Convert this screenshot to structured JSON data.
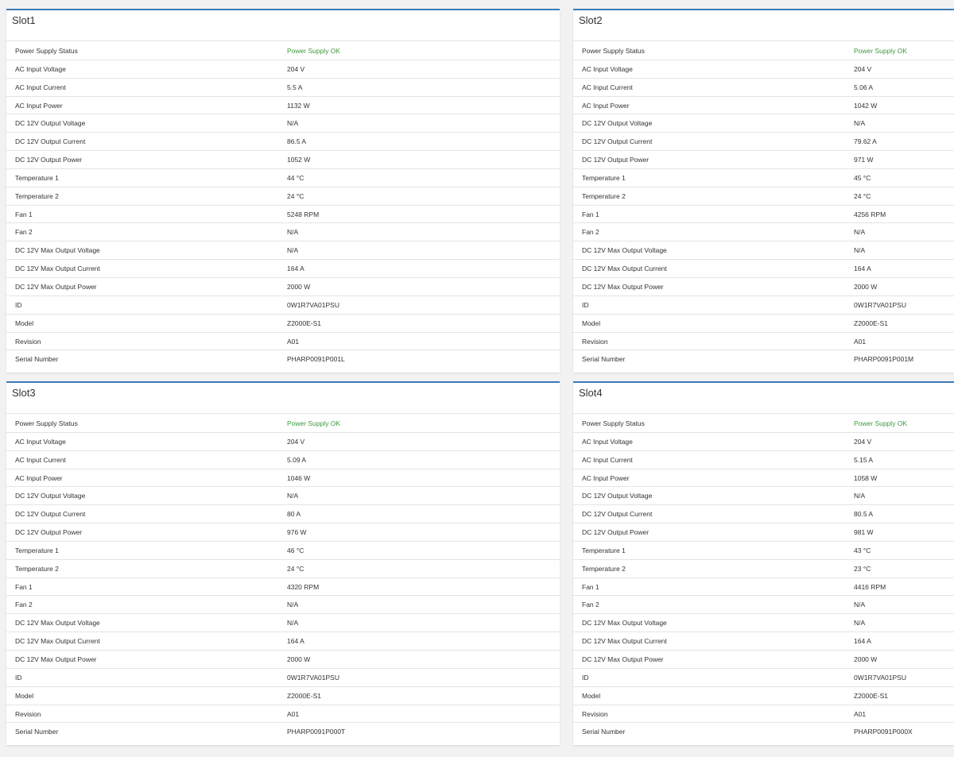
{
  "colors": {
    "accent": "#3c7ab8",
    "ok": "#3c9a3c",
    "background": "#f2f2f2"
  },
  "slots": [
    {
      "title": "Slot1",
      "rows": [
        {
          "label": "Power Supply Status",
          "value": "Power Supply OK",
          "status": "ok"
        },
        {
          "label": "AC Input Voltage",
          "value": "204 V"
        },
        {
          "label": "AC Input Current",
          "value": "5.5 A"
        },
        {
          "label": "AC Input Power",
          "value": "1132 W"
        },
        {
          "label": "DC 12V Output Voltage",
          "value": "N/A"
        },
        {
          "label": "DC 12V Output Current",
          "value": "86.5 A"
        },
        {
          "label": "DC 12V Output Power",
          "value": "1052 W"
        },
        {
          "label": "Temperature 1",
          "value": "44 °C"
        },
        {
          "label": "Temperature 2",
          "value": "24 °C"
        },
        {
          "label": "Fan 1",
          "value": "5248 RPM"
        },
        {
          "label": "Fan 2",
          "value": "N/A"
        },
        {
          "label": "DC 12V Max Output Voltage",
          "value": "N/A"
        },
        {
          "label": "DC 12V Max Output Current",
          "value": "164 A"
        },
        {
          "label": "DC 12V Max Output Power",
          "value": "2000 W"
        },
        {
          "label": "ID",
          "value": "0W1R7VA01PSU"
        },
        {
          "label": "Model",
          "value": "Z2000E-S1"
        },
        {
          "label": "Revision",
          "value": "A01"
        },
        {
          "label": "Serial Number",
          "value": "PHARP0091P001L"
        }
      ]
    },
    {
      "title": "Slot2",
      "rows": [
        {
          "label": "Power Supply Status",
          "value": "Power Supply OK",
          "status": "ok"
        },
        {
          "label": "AC Input Voltage",
          "value": "204 V"
        },
        {
          "label": "AC Input Current",
          "value": "5.06 A"
        },
        {
          "label": "AC Input Power",
          "value": "1042 W"
        },
        {
          "label": "DC 12V Output Voltage",
          "value": "N/A"
        },
        {
          "label": "DC 12V Output Current",
          "value": "79.62 A"
        },
        {
          "label": "DC 12V Output Power",
          "value": "971 W"
        },
        {
          "label": "Temperature 1",
          "value": "45 °C"
        },
        {
          "label": "Temperature 2",
          "value": "24 °C"
        },
        {
          "label": "Fan 1",
          "value": "4256 RPM"
        },
        {
          "label": "Fan 2",
          "value": "N/A"
        },
        {
          "label": "DC 12V Max Output Voltage",
          "value": "N/A"
        },
        {
          "label": "DC 12V Max Output Current",
          "value": "164 A"
        },
        {
          "label": "DC 12V Max Output Power",
          "value": "2000 W"
        },
        {
          "label": "ID",
          "value": "0W1R7VA01PSU"
        },
        {
          "label": "Model",
          "value": "Z2000E-S1"
        },
        {
          "label": "Revision",
          "value": "A01"
        },
        {
          "label": "Serial Number",
          "value": "PHARP0091P001M"
        }
      ]
    },
    {
      "title": "Slot3",
      "rows": [
        {
          "label": "Power Supply Status",
          "value": "Power Supply OK",
          "status": "ok"
        },
        {
          "label": "AC Input Voltage",
          "value": "204 V"
        },
        {
          "label": "AC Input Current",
          "value": "5.09 A"
        },
        {
          "label": "AC Input Power",
          "value": "1046 W"
        },
        {
          "label": "DC 12V Output Voltage",
          "value": "N/A"
        },
        {
          "label": "DC 12V Output Current",
          "value": "80 A"
        },
        {
          "label": "DC 12V Output Power",
          "value": "976 W"
        },
        {
          "label": "Temperature 1",
          "value": "46 °C"
        },
        {
          "label": "Temperature 2",
          "value": "24 °C"
        },
        {
          "label": "Fan 1",
          "value": "4320 RPM"
        },
        {
          "label": "Fan 2",
          "value": "N/A"
        },
        {
          "label": "DC 12V Max Output Voltage",
          "value": "N/A"
        },
        {
          "label": "DC 12V Max Output Current",
          "value": "164 A"
        },
        {
          "label": "DC 12V Max Output Power",
          "value": "2000 W"
        },
        {
          "label": "ID",
          "value": "0W1R7VA01PSU"
        },
        {
          "label": "Model",
          "value": "Z2000E-S1"
        },
        {
          "label": "Revision",
          "value": "A01"
        },
        {
          "label": "Serial Number",
          "value": "PHARP0091P000T"
        }
      ]
    },
    {
      "title": "Slot4",
      "rows": [
        {
          "label": "Power Supply Status",
          "value": "Power Supply OK",
          "status": "ok"
        },
        {
          "label": "AC Input Voltage",
          "value": "204 V"
        },
        {
          "label": "AC Input Current",
          "value": "5.15 A"
        },
        {
          "label": "AC Input Power",
          "value": "1058 W"
        },
        {
          "label": "DC 12V Output Voltage",
          "value": "N/A"
        },
        {
          "label": "DC 12V Output Current",
          "value": "80.5 A"
        },
        {
          "label": "DC 12V Output Power",
          "value": "981 W"
        },
        {
          "label": "Temperature 1",
          "value": "43 °C"
        },
        {
          "label": "Temperature 2",
          "value": "23 °C"
        },
        {
          "label": "Fan 1",
          "value": "4416 RPM"
        },
        {
          "label": "Fan 2",
          "value": "N/A"
        },
        {
          "label": "DC 12V Max Output Voltage",
          "value": "N/A"
        },
        {
          "label": "DC 12V Max Output Current",
          "value": "164 A"
        },
        {
          "label": "DC 12V Max Output Power",
          "value": "2000 W"
        },
        {
          "label": "ID",
          "value": "0W1R7VA01PSU"
        },
        {
          "label": "Model",
          "value": "Z2000E-S1"
        },
        {
          "label": "Revision",
          "value": "A01"
        },
        {
          "label": "Serial Number",
          "value": "PHARP0091P000X"
        }
      ]
    }
  ]
}
